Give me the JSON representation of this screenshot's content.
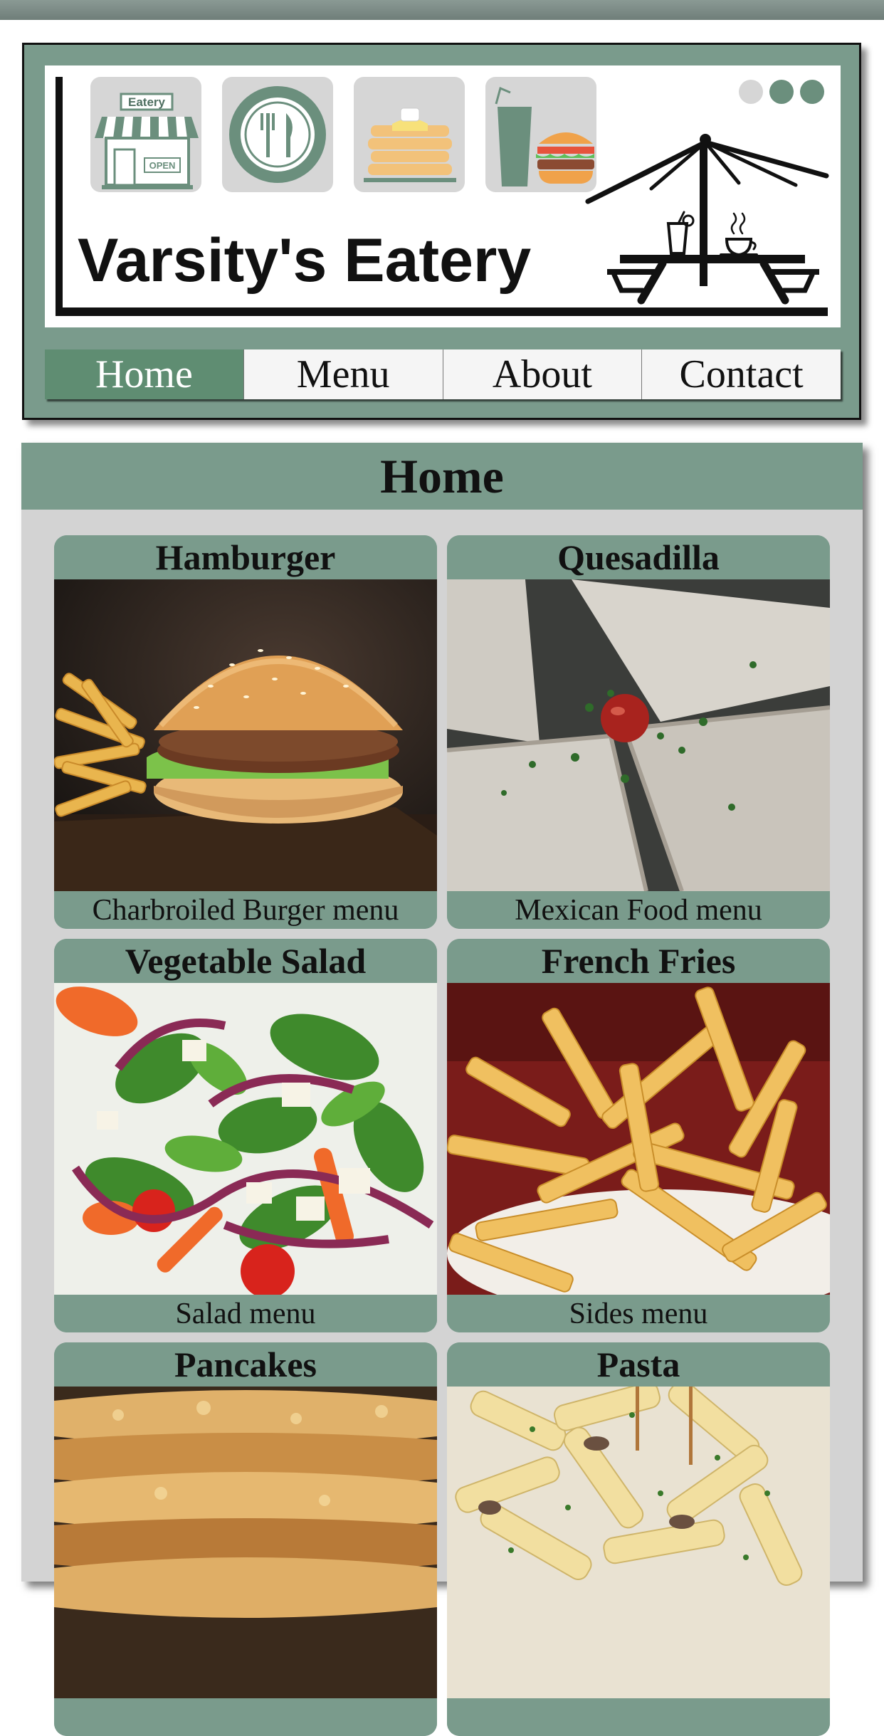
{
  "banner": {
    "brand_name": "Varsity's Eatery",
    "storefront_sign": "Eatery",
    "storefront_door_sign": "OPEN"
  },
  "nav": {
    "items": [
      {
        "label": "Home",
        "active": true
      },
      {
        "label": "Menu",
        "active": false
      },
      {
        "label": "About",
        "active": false
      },
      {
        "label": "Contact",
        "active": false
      }
    ]
  },
  "main": {
    "heading": "Home",
    "cards": [
      {
        "title": "Hamburger",
        "caption": "Charbroiled Burger menu",
        "image": "burger-photo"
      },
      {
        "title": "Quesadilla",
        "caption": "Mexican Food menu",
        "image": "quesadilla-photo"
      },
      {
        "title": "Vegetable Salad",
        "caption": "Salad menu",
        "image": "salad-photo"
      },
      {
        "title": "French Fries",
        "caption": "Sides menu",
        "image": "fries-photo"
      },
      {
        "title": "Pancakes",
        "caption": "",
        "image": "pancakes-photo"
      },
      {
        "title": "Pasta",
        "caption": "",
        "image": "pasta-photo"
      }
    ]
  },
  "colors": {
    "sage": "#7a9b8c",
    "nav_active": "#5f8d72",
    "content_bg": "#d3d3d3"
  }
}
